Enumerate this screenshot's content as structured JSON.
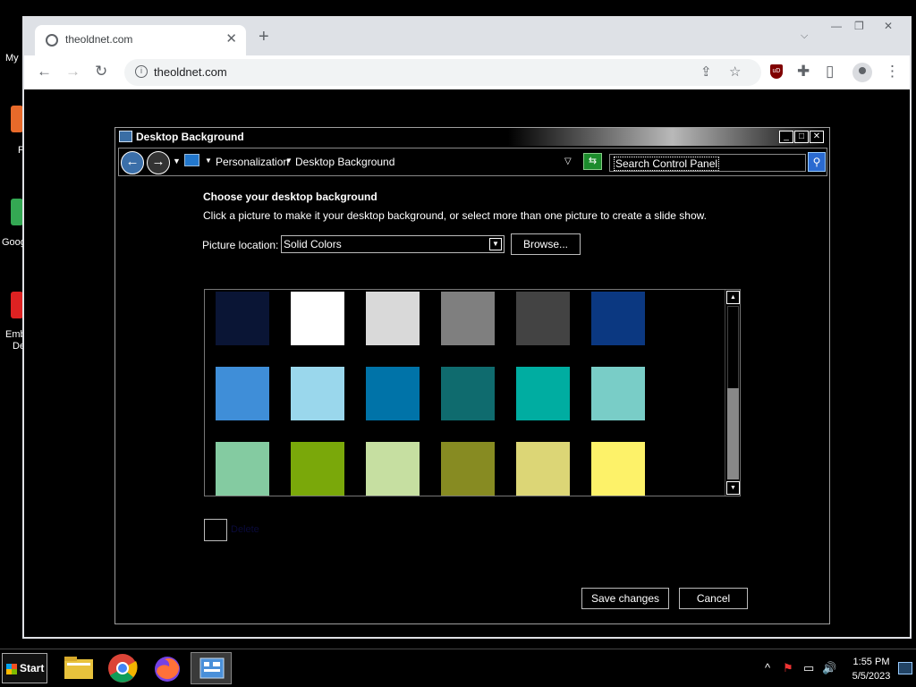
{
  "desktop": {
    "icon_labels": [
      "My",
      "F",
      "Goog",
      "Emb",
      "De"
    ]
  },
  "browser": {
    "tab_title": "theoldnet.com",
    "tab_close": "✕",
    "new_tab": "+",
    "tab_menu": "⌵",
    "url": "theoldnet.com",
    "back": "←",
    "forward": "→",
    "reload": "↻",
    "share": "⇪",
    "bookmark": "☆",
    "extensions": "✚",
    "sidepanel": "▯",
    "menu": "⋮",
    "ublock": "uD",
    "window_controls": [
      "—",
      "❐",
      "✕"
    ]
  },
  "dialog": {
    "title": "Desktop Background",
    "window_buttons": [
      "_",
      "□",
      "✕"
    ],
    "breadcrumb": [
      "Personalization",
      "Desktop Background"
    ],
    "search_placeholder": "Search Control Panel",
    "heading": "Choose your desktop background",
    "instructions": "Click a picture to make it your desktop background, or select more than one picture to create a slide show.",
    "picture_location_label": "Picture location:",
    "picture_location_value": "Solid Colors",
    "browse_label": "Browse...",
    "slideshow_label": "Delete",
    "save_label": "Save changes",
    "cancel_label": "Cancel",
    "swatch_colors": [
      "#0a1535",
      "#ffffff",
      "#d9d9d9",
      "#7f7f7f",
      "#434343",
      "#0b3881",
      "#3f8ed8",
      "#9ad7ec",
      "#0073a8",
      "#0f6b6e",
      "#00ada1",
      "#79cdc7",
      "#84cba1",
      "#7aa80a",
      "#c6dfa1",
      "#878b22",
      "#dcd676",
      "#fdf269"
    ]
  },
  "taskbar": {
    "start_label": "Start",
    "time": "1:55 PM",
    "date": "5/5/2023",
    "tray_icons": [
      "^",
      "⚑",
      "▭",
      "🔊"
    ]
  }
}
